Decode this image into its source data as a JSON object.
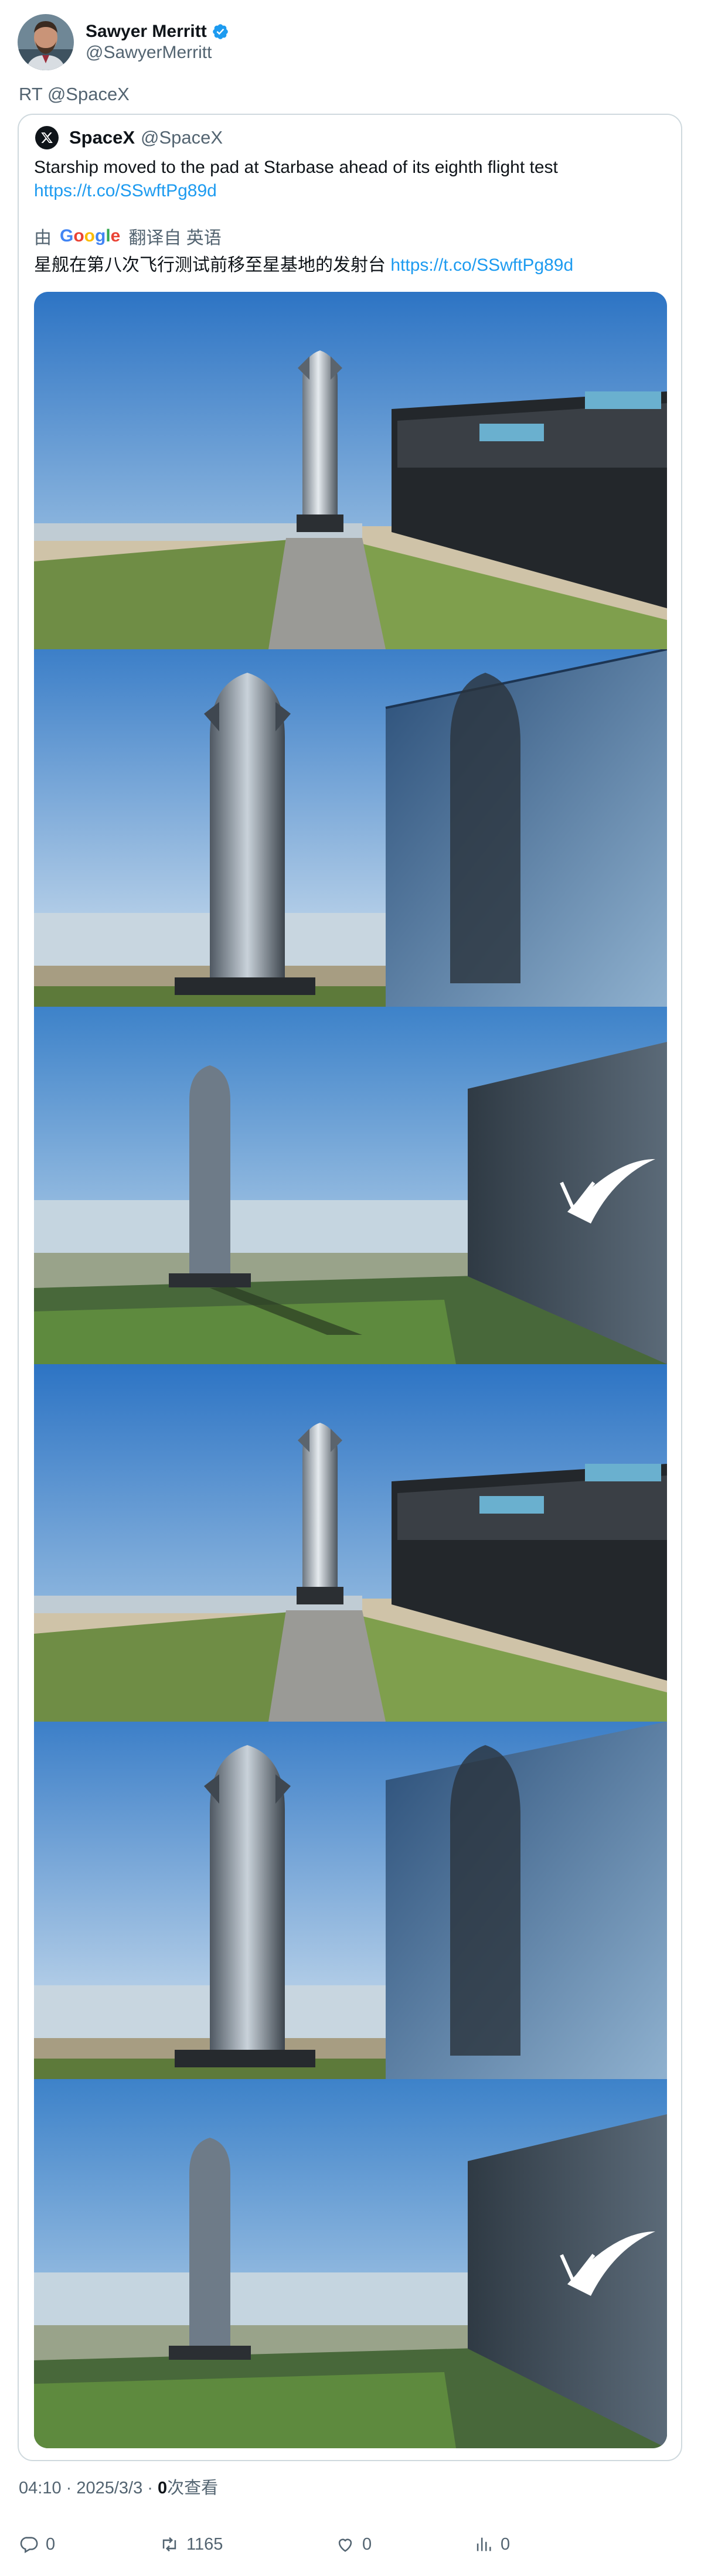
{
  "author": {
    "display_name": "Sawyer Merritt",
    "handle": "@SawyerMerritt",
    "verified_icon": "verified-badge-icon",
    "avatar_icon": "profile-avatar"
  },
  "retweet_label": "RT @SpaceX",
  "quoted_tweet": {
    "display_name": "SpaceX",
    "handle": "@SpaceX",
    "text": "Starship moved to the pad at Starbase ahead of its eighth flight test",
    "link": "https://t.co/SSwftPg89d",
    "translation": {
      "by_label": "由",
      "provider": "Google",
      "translated_from": "翻译自 英语",
      "text": "星舰在第八次飞行测试前移至星基地的发射台",
      "link": "https://t.co/SSwftPg89d"
    },
    "photos": [
      "photo-1",
      "photo-2",
      "photo-3",
      "photo-4",
      "photo-5",
      "photo-6"
    ]
  },
  "meta": {
    "time_date": "04:10 · 2025/3/3 · ",
    "views_count": "0",
    "views_label": "次查看"
  },
  "actions": {
    "reply": "0",
    "retweet": "1165",
    "like": "0",
    "views": "0"
  },
  "colors": {
    "accent": "#1d9bf0",
    "muted": "#536471",
    "border": "#cfd9de"
  }
}
